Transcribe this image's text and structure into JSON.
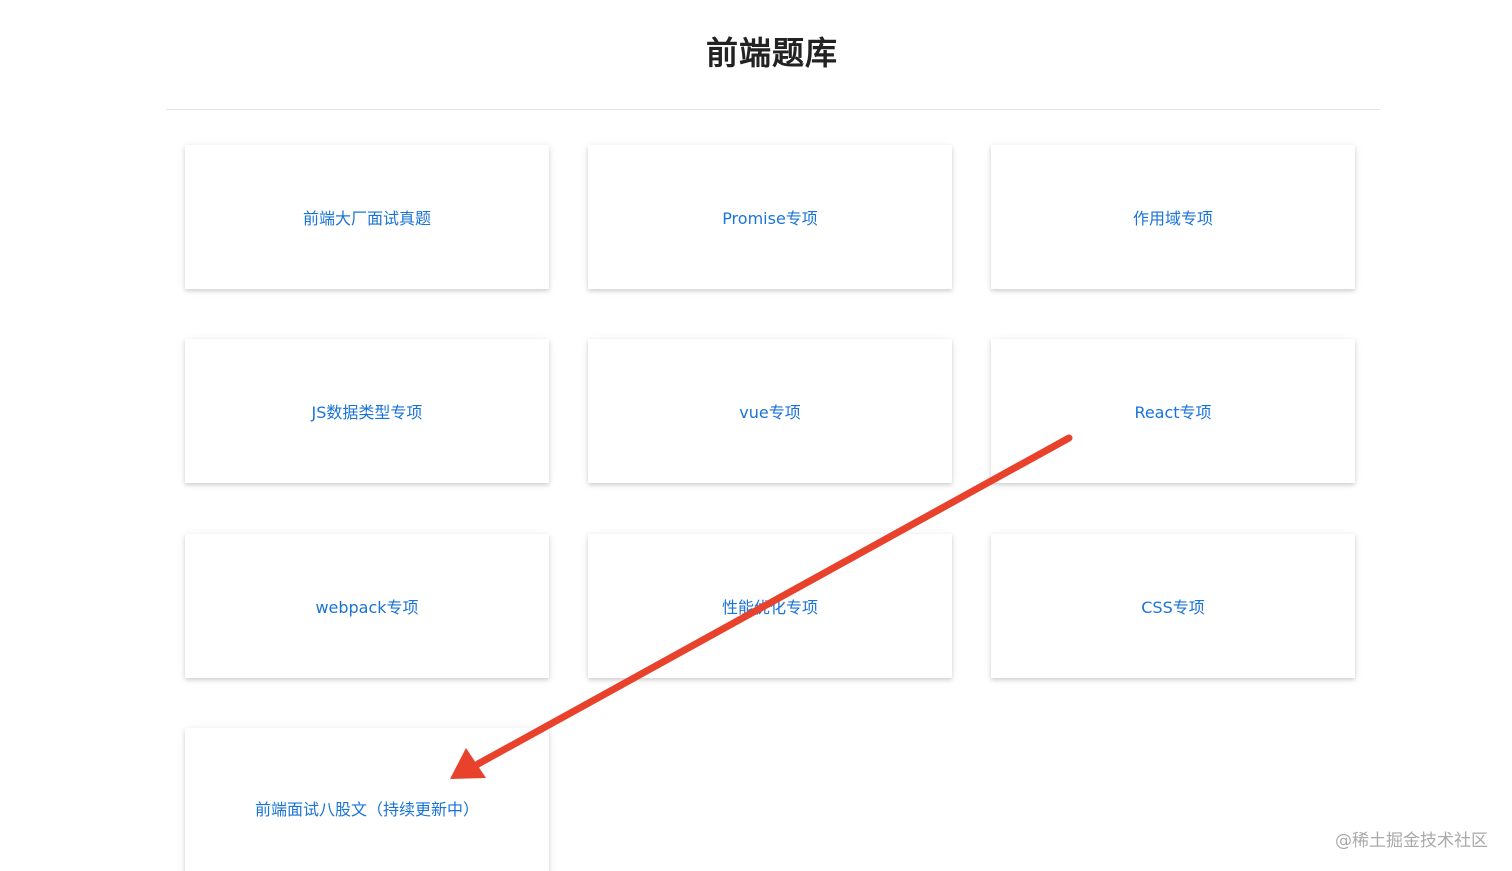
{
  "page": {
    "title": "前端题库"
  },
  "cards": [
    {
      "label": "前端大厂面试真题"
    },
    {
      "label": "Promise专项"
    },
    {
      "label": "作用域专项"
    },
    {
      "label": "JS数据类型专项"
    },
    {
      "label": "vue专项"
    },
    {
      "label": "React专项"
    },
    {
      "label": "webpack专项"
    },
    {
      "label": "性能优化专项"
    },
    {
      "label": "CSS专项"
    },
    {
      "label": "前端面试八股文（持续更新中）"
    }
  ],
  "annotation": {
    "arrow_color": "#e8412c"
  },
  "watermark": {
    "text": "@稀土掘金技术社区"
  },
  "colors": {
    "link_blue": "#1a73d9",
    "title_text": "#222222"
  },
  "icons": {
    "annotation_arrow": "red-arrow-icon"
  }
}
